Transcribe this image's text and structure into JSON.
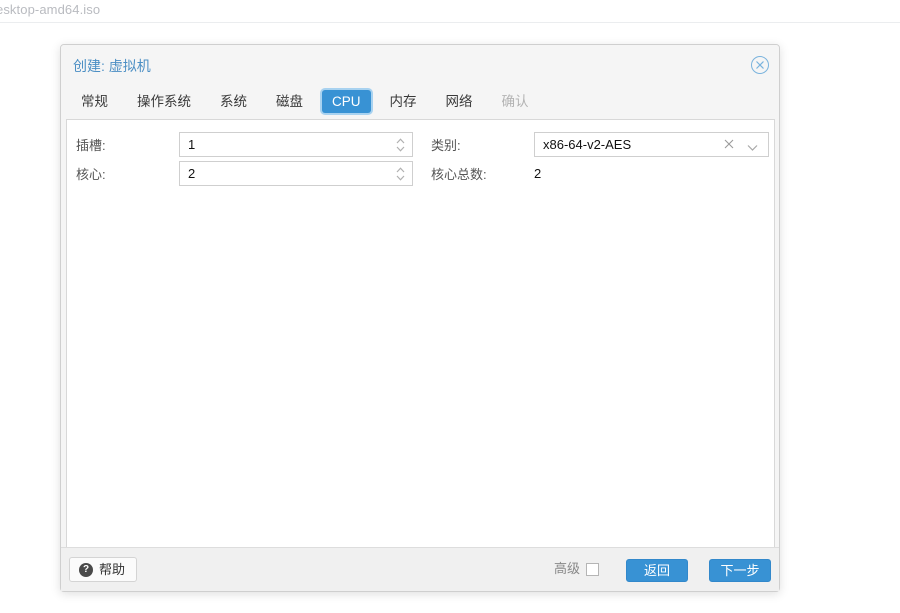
{
  "background": {
    "filename_text": "esktop-amd64.iso"
  },
  "dialog": {
    "title": "创建: 虚拟机",
    "close_icon": "close-circle-icon",
    "tabs": [
      {
        "label": "常规",
        "state": "normal"
      },
      {
        "label": "操作系统",
        "state": "normal"
      },
      {
        "label": "系统",
        "state": "normal"
      },
      {
        "label": "磁盘",
        "state": "normal"
      },
      {
        "label": "CPU",
        "state": "active"
      },
      {
        "label": "内存",
        "state": "normal"
      },
      {
        "label": "网络",
        "state": "normal"
      },
      {
        "label": "确认",
        "state": "disabled"
      }
    ],
    "form": {
      "sockets": {
        "label": "插槽:",
        "value": "1",
        "spinner_icon": "spinner-updown-icon"
      },
      "cores": {
        "label": "核心:",
        "value": "2",
        "spinner_icon": "spinner-updown-icon"
      },
      "type": {
        "label": "类别:",
        "value": "x86-64-v2-AES",
        "clear_icon": "clear-x-icon",
        "arrow_icon": "chevron-down-icon"
      },
      "total_cores": {
        "label": "核心总数:",
        "value": "2"
      }
    },
    "footer": {
      "help_label": "帮助",
      "help_icon": "question-mark-icon",
      "advanced_label": "高级",
      "advanced_checked": false,
      "back_label": "返回",
      "next_label": "下一步"
    }
  },
  "colors": {
    "accent": "#3892d4",
    "title": "#4c8fc4",
    "panel_bg": "#ffffff",
    "header_bg": "#f5f5f5",
    "footer_bg": "#f0f0f0",
    "disabled_text": "#b3b3b3"
  }
}
